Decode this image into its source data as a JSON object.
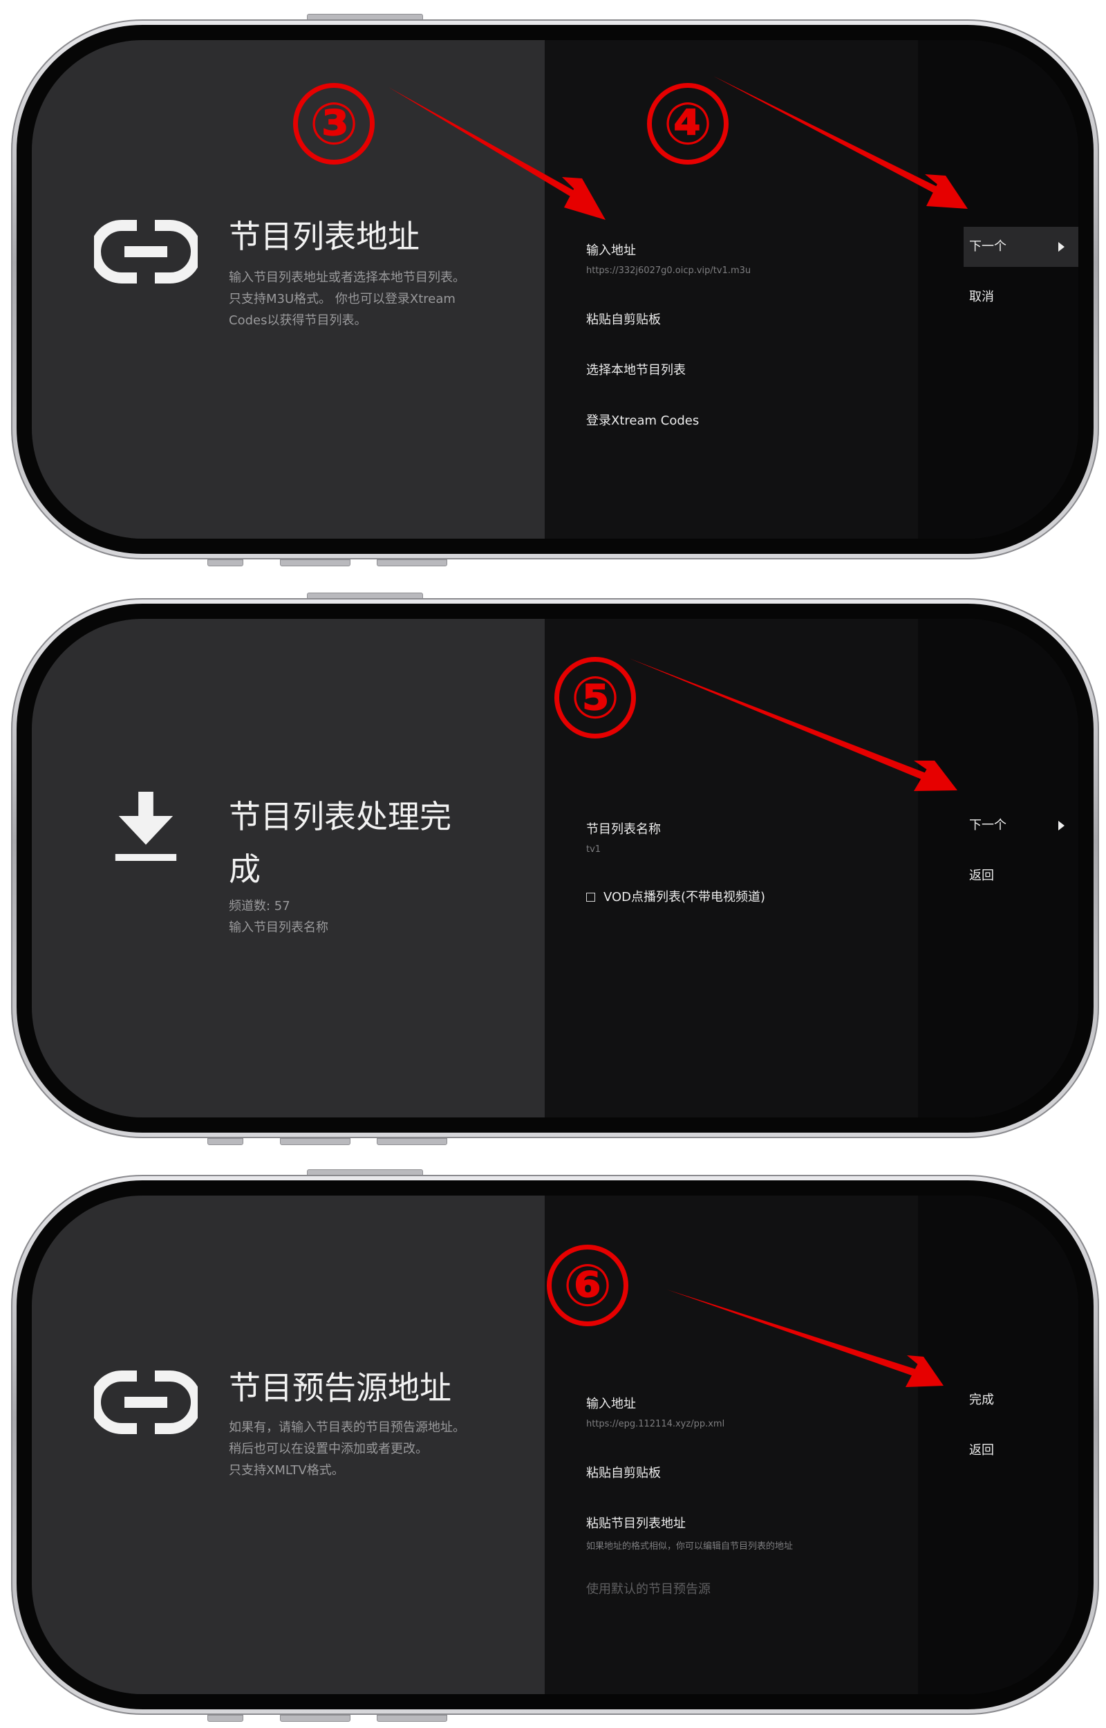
{
  "arrow_color": "#e60000",
  "screen1": {
    "icon": "link-icon",
    "title": "节目列表地址",
    "desc_lines": [
      "输入节目列表地址或者选择本地节目列表。",
      "只支持M3U格式。 你也可以登录Xtream",
      "Codes以获得节目列表。"
    ],
    "options": [
      {
        "label": "输入地址",
        "sub": "https://332j6027g0.oicp.vip/tv1.m3u"
      },
      {
        "label": "粘贴自剪贴板"
      },
      {
        "label": "选择本地节目列表"
      },
      {
        "label": "登录Xtream Codes"
      }
    ],
    "actions": [
      {
        "label": "下一个",
        "selected": true
      },
      {
        "label": "取消"
      }
    ],
    "badges": [
      "③",
      "④"
    ]
  },
  "screen2": {
    "icon": "download-icon",
    "title_lines": [
      "节目列表处理完",
      "成"
    ],
    "desc_lines": [
      "频道数: 57",
      "输入节目列表名称"
    ],
    "options": [
      {
        "label": "节目列表名称",
        "sub": "tv1"
      },
      {
        "label": "VOD点播列表(不带电视频道)",
        "checkbox": true
      }
    ],
    "actions": [
      {
        "label": "下一个"
      },
      {
        "label": "返回"
      }
    ],
    "badges": [
      "⑤"
    ]
  },
  "screen3": {
    "icon": "link-icon",
    "title": "节目预告源地址",
    "desc_lines": [
      "如果有，请输入节目表的节目预告源地址。",
      "稍后也可以在设置中添加或者更改。",
      "只支持XMLTV格式。"
    ],
    "options": [
      {
        "label": "输入地址",
        "sub": "https://epg.112114.xyz/pp.xml"
      },
      {
        "label": "粘贴自剪贴板"
      },
      {
        "label": "粘贴节目列表地址",
        "sub": "如果地址的格式相似，你可以编辑自节目列表的地址"
      },
      {
        "label": "使用默认的节目预告源",
        "disabled": true
      }
    ],
    "actions": [
      {
        "label": "完成"
      },
      {
        "label": "返回"
      }
    ],
    "badges": [
      "⑥"
    ]
  }
}
